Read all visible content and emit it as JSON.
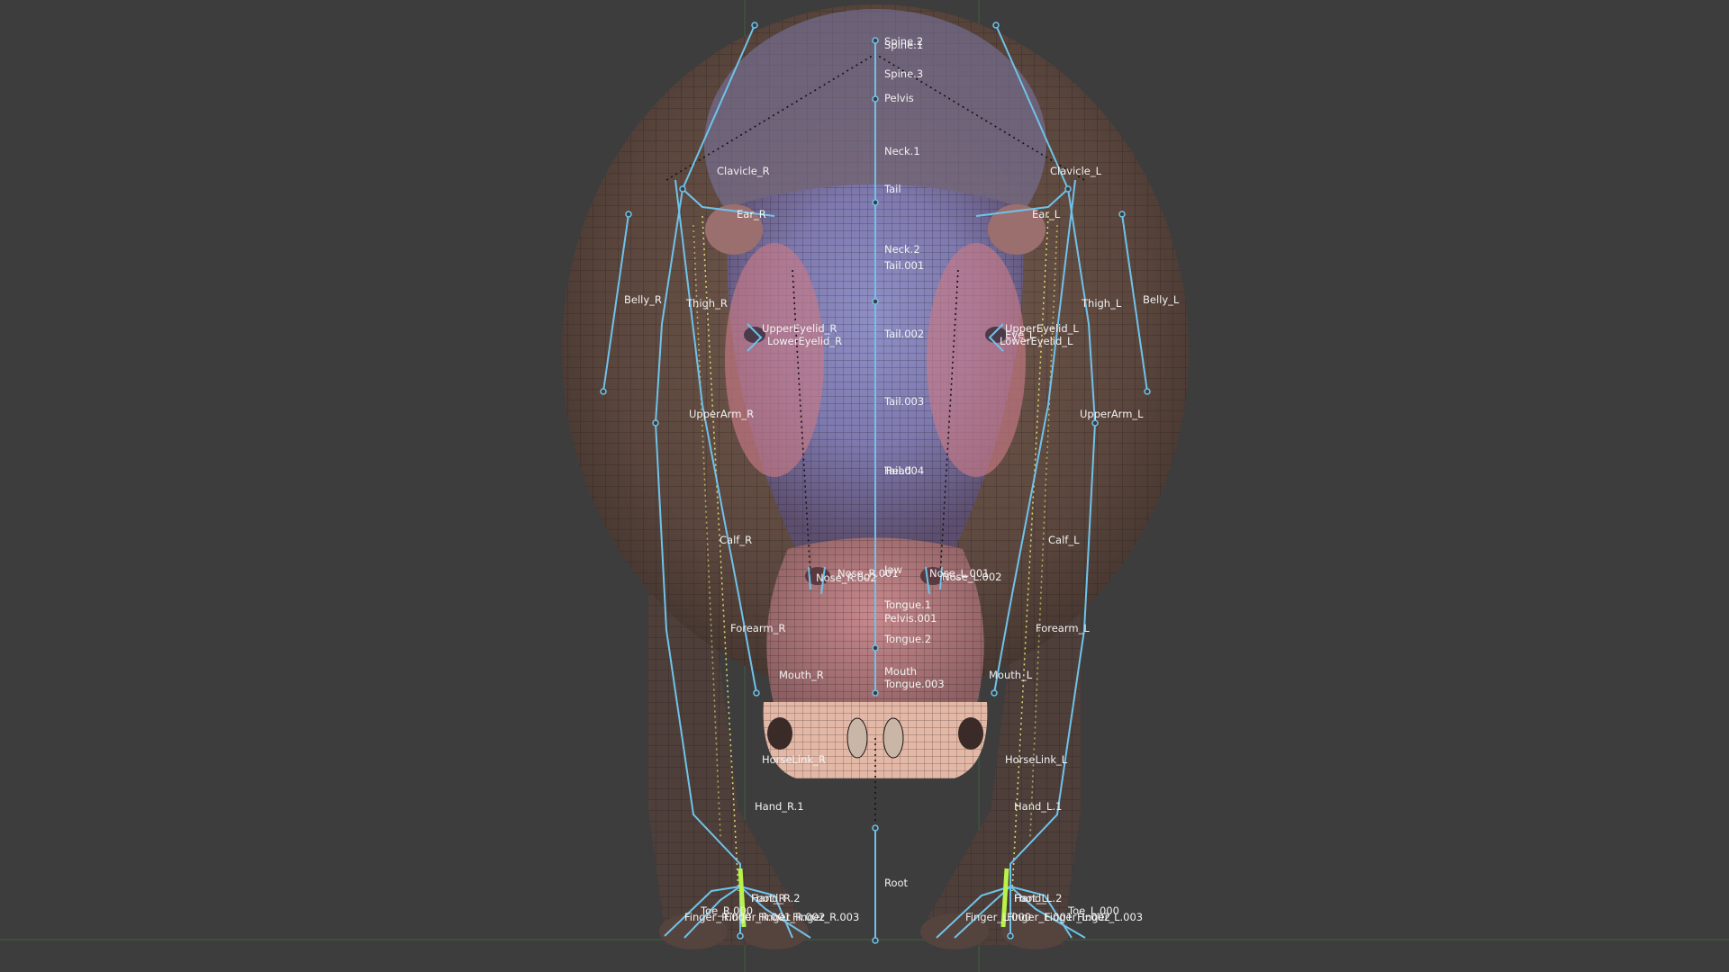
{
  "viewport": {
    "background": "#3d3d3d",
    "bone_color": "#6fc3ea",
    "selected_bone_color": "#b8f24a",
    "relationship_line_color": "#d8d86a"
  },
  "bones": {
    "spine_2": "Spine.2",
    "spine_1": "Spine.1",
    "spine_3": "Spine.3",
    "pelvis": "Pelvis",
    "neck_1": "Neck.1",
    "tail": "Tail",
    "neck_2": "Neck.2",
    "tail_001": "Tail.001",
    "tail_002": "Tail.002",
    "tail_003": "Tail.003",
    "tail_004": "Tail.004",
    "head": "Head",
    "jaw": "Jaw",
    "tongue_1": "Tongue.1",
    "pelvis_001": "Pelvis.001",
    "tongue_2": "Tongue.2",
    "mouth": "Mouth",
    "tongue_003": "Tongue.003",
    "root": "Root",
    "clavicle_r": "Clavicle_R",
    "clavicle_l": "Clavicle_L",
    "ear_r": "Ear_R",
    "ear_l": "Ear_L",
    "belly_r": "Belly_R",
    "belly_l": "Belly_L",
    "thigh_r": "Thigh_R",
    "thigh_l": "Thigh_L",
    "uppereyelid_r": "UpperEyelid_R",
    "lowereyelid_r": "LowerEyelid_R",
    "uppereyelid_l": "UpperEyelid_L",
    "lowereyelid_l": "LowerEyelid_L",
    "eye_l": "Eye_L",
    "upperarm_r": "UpperArm_R",
    "upperarm_l": "UpperArm_L",
    "calf_r": "Calf_R",
    "calf_l": "Calf_L",
    "nose_r": "Nose_R.002",
    "nose_r_001": "Nose_R.001",
    "nose_l_001": "Nose_L.001",
    "nose_l": "Nose_L.002",
    "forearm_r": "Forearm_R",
    "forearm_l": "Forearm_L",
    "mouth_r": "Mouth_R",
    "mouth_l": "Mouth_L",
    "horselink_r": "HorseLink_R",
    "horselink_l": "HorseLink_L",
    "hand_r_1": "Hand_R.1",
    "hand_l_1": "Hand_L.1",
    "hand_r_2": "Hand_R.2",
    "foot_r": "Foot_R",
    "hand_l_2": "Hand_L.2",
    "foot_l": "Foot_L",
    "finger_r_003": "Finger_R.003",
    "finger_r_002": "Finger_R.002",
    "finger_r_001": "Finger_R.001",
    "finger_r_000": "Finger_R.000",
    "toe_r": "Toe_R.000",
    "finger_l_000": "Finger_L.000",
    "finger_l_001": "Finger_L.001",
    "finger_l_002": "Finger_L.002",
    "toe_l_000": "Toe_L.000",
    "finger_l_003": "Finger_L.003"
  }
}
